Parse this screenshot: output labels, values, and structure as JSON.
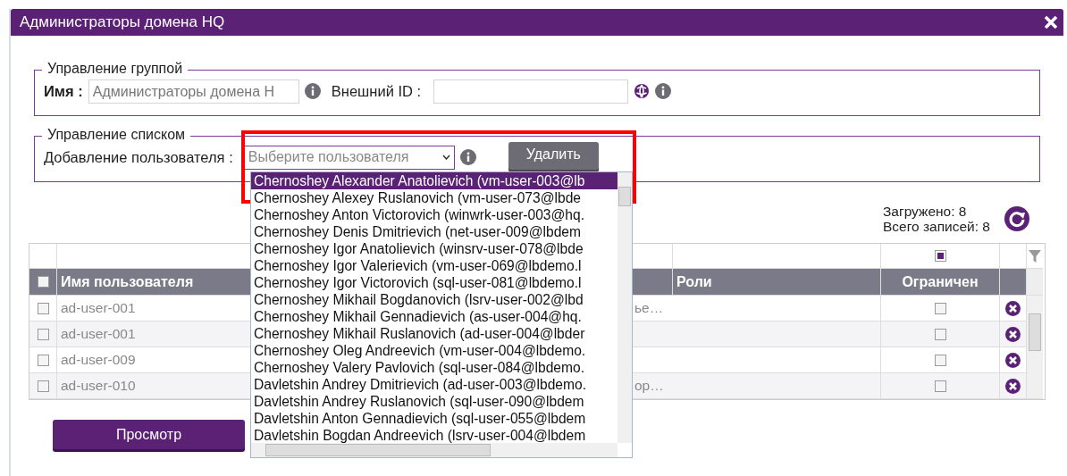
{
  "window": {
    "title": "Администраторы домена HQ"
  },
  "group_section": {
    "legend": "Управление группой",
    "name_label": "Имя :",
    "name_value": "Администраторы домена H",
    "external_id_label": "Внешний ID :"
  },
  "list_section": {
    "legend": "Управление списком",
    "add_label": "Добавление пользователя :",
    "select_placeholder": "Выберите пользователя",
    "delete_button": "Удалить"
  },
  "user_options": [
    {
      "label": "Chernoshey Alexander Anatolievich (vm-user-003@lb",
      "selected": true
    },
    {
      "label": "Chernoshey Alexey Ruslanovich (vm-user-073@lbde",
      "selected": false
    },
    {
      "label": "Chernoshey Anton Victorovich (winwrk-user-003@hq.",
      "selected": false
    },
    {
      "label": "Chernoshey Denis Dmitrievich (net-user-009@lbdem",
      "selected": false
    },
    {
      "label": "Chernoshey Igor Anatolievich (winsrv-user-078@lbde",
      "selected": false
    },
    {
      "label": "Chernoshey Igor Valerievich (vm-user-069@lbdemo.l",
      "selected": false
    },
    {
      "label": "Chernoshey Igor Victorovich (sql-user-081@lbdemo.l",
      "selected": false
    },
    {
      "label": "Chernoshey Mikhail Bogdanovich (lsrv-user-002@lbd",
      "selected": false
    },
    {
      "label": "Chernoshey Mikhail Gennadievich (as-user-004@hq.",
      "selected": false
    },
    {
      "label": "Chernoshey Mikhail Ruslanovich (ad-user-004@lbder",
      "selected": false
    },
    {
      "label": "Chernoshey Oleg Andreevich (vm-user-004@lbdemo.",
      "selected": false
    },
    {
      "label": "Chernoshey Valery Pavlovich (sql-user-084@lbdemo.",
      "selected": false
    },
    {
      "label": "Davletshin Andrey Dmitrievich (ad-user-003@lbdemo.",
      "selected": false
    },
    {
      "label": "Davletshin Andrey Ruslanovich (sql-user-090@lbdem",
      "selected": false
    },
    {
      "label": "Davletshin Anton Gennadievich (sql-user-055@lbdem",
      "selected": false
    },
    {
      "label": "Davletshin Bogdan Andreevich (lsrv-user-004@lbdem",
      "selected": false
    }
  ],
  "counters": {
    "loaded": "Загружено: 8",
    "total": "Всего записей: 8"
  },
  "table": {
    "header_checked": false,
    "restricted_filter_checked": true,
    "username_header": "Имя пользователя",
    "roles_header": "Роли",
    "restricted_header": "Ограничен",
    "rows": [
      {
        "checked": false,
        "username": "ad-user-001",
        "column_3": "ье…",
        "restricted": false
      },
      {
        "checked": false,
        "username": "ad-user-001",
        "restricted": false
      },
      {
        "checked": false,
        "username": "ad-user-009",
        "restricted": false
      },
      {
        "checked": false,
        "username": "ad-user-010",
        "column_3": "ор…",
        "restricted": false
      }
    ]
  },
  "view_button": "Просмотр"
}
